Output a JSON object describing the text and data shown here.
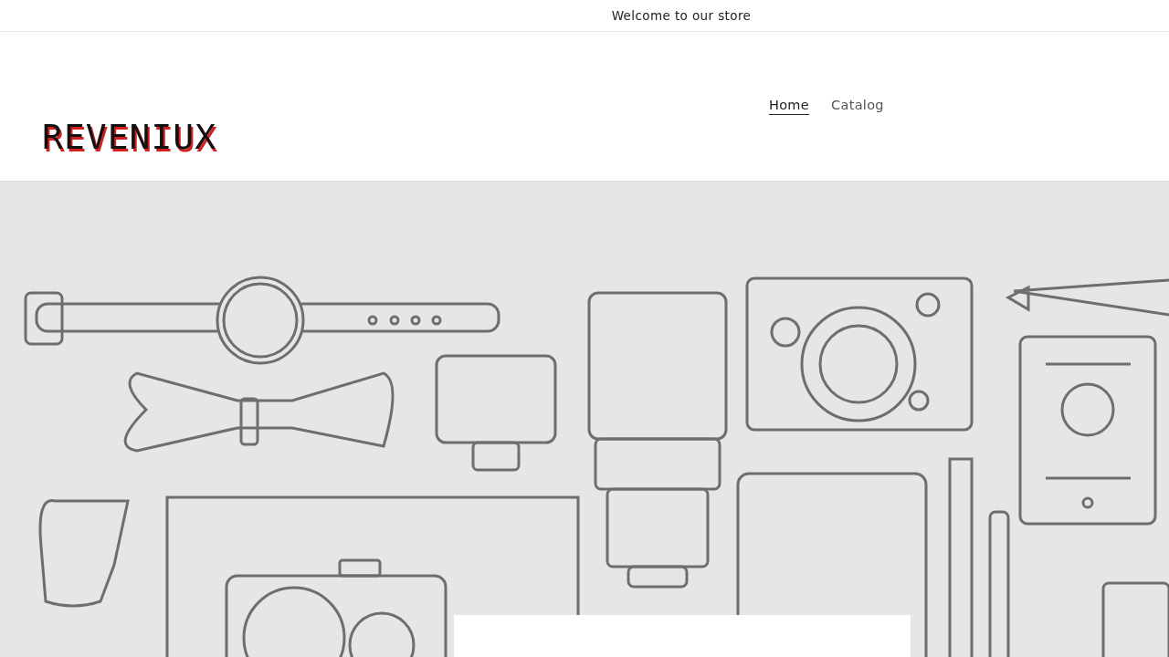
{
  "announcement": {
    "text": "Welcome to our store"
  },
  "header": {
    "logo": "REVENIUX",
    "nav": [
      {
        "label": "Home",
        "selected": true
      },
      {
        "label": "Catalog",
        "selected": false
      }
    ]
  }
}
